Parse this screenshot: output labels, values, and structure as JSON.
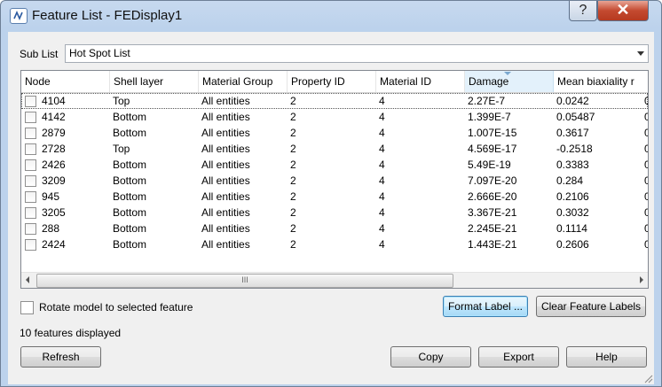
{
  "window": {
    "title": "Feature List - FEDisplay1",
    "help_glyph": "?",
    "close_glyph": "✕"
  },
  "sublist": {
    "label": "Sub List",
    "value": "Hot Spot List"
  },
  "table": {
    "columns": [
      "Node",
      "Shell layer",
      "Material Group",
      "Property ID",
      "Material ID",
      "Damage",
      "Mean biaxiality r"
    ],
    "rows": [
      {
        "node": "4104",
        "layer": "Top",
        "group": "All entities",
        "prop": "2",
        "mat": "4",
        "damage": "2.27E-7",
        "biax": "0.0242",
        "extra": "0"
      },
      {
        "node": "4142",
        "layer": "Bottom",
        "group": "All entities",
        "prop": "2",
        "mat": "4",
        "damage": "1.399E-7",
        "biax": "0.05487",
        "extra": "0"
      },
      {
        "node": "2879",
        "layer": "Bottom",
        "group": "All entities",
        "prop": "2",
        "mat": "4",
        "damage": "1.007E-15",
        "biax": "0.3617",
        "extra": "0"
      },
      {
        "node": "2728",
        "layer": "Top",
        "group": "All entities",
        "prop": "2",
        "mat": "4",
        "damage": "4.569E-17",
        "biax": "-0.2518",
        "extra": "0"
      },
      {
        "node": "2426",
        "layer": "Bottom",
        "group": "All entities",
        "prop": "2",
        "mat": "4",
        "damage": "5.49E-19",
        "biax": "0.3383",
        "extra": "0"
      },
      {
        "node": "3209",
        "layer": "Bottom",
        "group": "All entities",
        "prop": "2",
        "mat": "4",
        "damage": "7.097E-20",
        "biax": "0.284",
        "extra": "0"
      },
      {
        "node": "945",
        "layer": "Bottom",
        "group": "All entities",
        "prop": "2",
        "mat": "4",
        "damage": "2.666E-20",
        "biax": "0.2106",
        "extra": "0"
      },
      {
        "node": "3205",
        "layer": "Bottom",
        "group": "All entities",
        "prop": "2",
        "mat": "4",
        "damage": "3.367E-21",
        "biax": "0.3032",
        "extra": "0"
      },
      {
        "node": "288",
        "layer": "Bottom",
        "group": "All entities",
        "prop": "2",
        "mat": "4",
        "damage": "2.245E-21",
        "biax": "0.1114",
        "extra": "0"
      },
      {
        "node": "2424",
        "layer": "Bottom",
        "group": "All entities",
        "prop": "2",
        "mat": "4",
        "damage": "1.443E-21",
        "biax": "0.2606",
        "extra": "0"
      }
    ],
    "scroll_thumb_glyph": "III"
  },
  "options": {
    "rotate_label": "Rotate model to selected feature"
  },
  "buttons": {
    "format_label": "Format Label ...",
    "clear_labels": "Clear Feature Labels",
    "refresh": "Refresh",
    "copy": "Copy",
    "export": "Export",
    "help": "Help"
  },
  "status": "10 features displayed"
}
